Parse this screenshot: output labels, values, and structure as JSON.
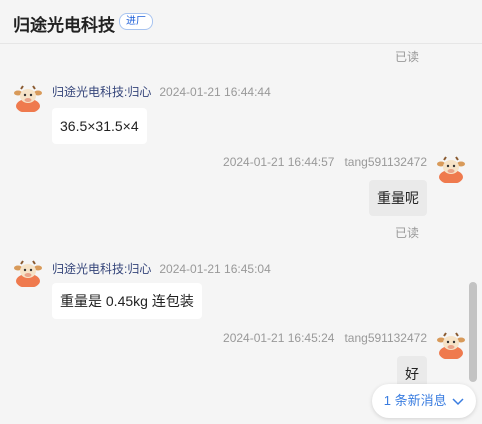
{
  "header": {
    "title": "归途光电科技",
    "tag": "进厂"
  },
  "read_label": "已读",
  "messages": [
    {
      "sender": "归途光电科技:归心",
      "time": "2024-01-21 16:44:44",
      "text": "36.5×31.5×4"
    },
    {
      "sender": "tang591132472",
      "time": "2024-01-21 16:44:57",
      "text": "重量呢"
    },
    {
      "sender": "归途光电科技:归心",
      "time": "2024-01-21 16:45:04",
      "text": "重量是 0.45kg 连包装"
    },
    {
      "sender": "tang591132472",
      "time": "2024-01-21 16:45:24",
      "text": "好"
    }
  ],
  "new_messages": {
    "label": "1 条新消息"
  },
  "colors": {
    "accent": "#3a7de0",
    "sender_name": "#35457a",
    "tag_border": "#a8c4f0"
  },
  "icons": {
    "avatar": "cartoon-cow-avatar-icon",
    "new_messages": "chevron-down-icon"
  }
}
